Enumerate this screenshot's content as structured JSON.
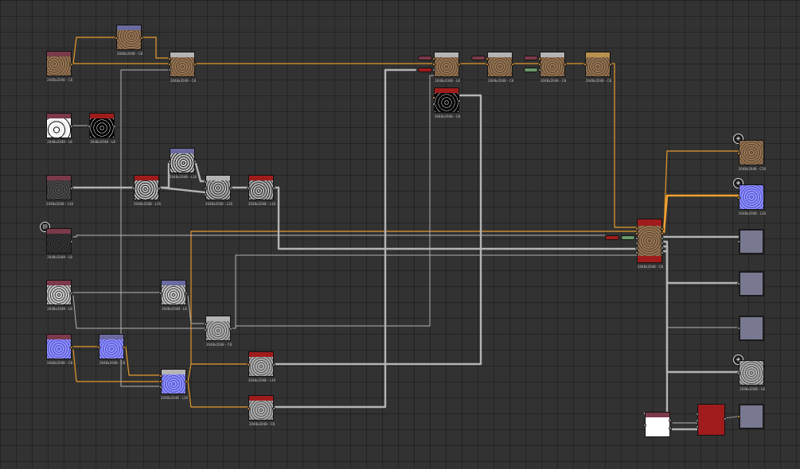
{
  "graph": {
    "nodes": [
      {
        "id": "n1",
        "label": "2048x2048 - C8"
      },
      {
        "id": "n2",
        "label": "2048x2048 - C8"
      },
      {
        "id": "n3",
        "label": "2048x2048 - C8"
      },
      {
        "id": "n4",
        "label": "2048x2048 - L8"
      },
      {
        "id": "n5",
        "label": "2048x2048 - L8"
      },
      {
        "id": "n6",
        "label": "2048x2048 - L16"
      },
      {
        "id": "n7",
        "label": "2048x2048 - L16"
      },
      {
        "id": "n8",
        "label": "2048x2048 - L16"
      },
      {
        "id": "n9",
        "label": "2048x2048 - L16"
      },
      {
        "id": "n10",
        "label": "2048x2048 - L16"
      },
      {
        "id": "n11",
        "label": "2048x2048 - L8"
      },
      {
        "id": "n12",
        "label": "2048x2048 - L8"
      },
      {
        "id": "n13",
        "label": "2048x2048 - L8"
      },
      {
        "id": "n14",
        "label": "2048x2048 - C8"
      },
      {
        "id": "n15",
        "label": "2048x2048 - C8"
      },
      {
        "id": "n16",
        "label": "2048x2048 - L8"
      },
      {
        "id": "n17",
        "label": "2048x2048 - C8"
      },
      {
        "id": "n18",
        "label": "2048x2048 - L16"
      },
      {
        "id": "n19",
        "label": "2048x2048 - L16"
      },
      {
        "id": "n20",
        "label": "2048x2048 - C8"
      },
      {
        "id": "n21",
        "label": "2048x2048 - L8"
      },
      {
        "id": "n22",
        "label": "2048x2048 - C8"
      },
      {
        "id": "n23",
        "label": "2048x2048 - C8"
      },
      {
        "id": "n24",
        "label": "2048x2048 - C8"
      },
      {
        "id": "n25",
        "label": "2048x2048 - C8"
      },
      {
        "id": "n26",
        "label": "2048x2048 - C8"
      },
      {
        "id": "n27",
        "label": "2048x2048 - C16"
      },
      {
        "id": "n28",
        "label": "2048x2048 - L16"
      },
      {
        "id": "n29",
        "label": "2048x2048 - L8"
      }
    ],
    "colors": {
      "wire_default": "#b4b4b4",
      "wire_color": "#e69a2e",
      "head_maroon": "#7a3a4a",
      "head_blue": "#6a6aa0",
      "head_red": "#a01c1c",
      "head_gray": "#b4b4b4",
      "head_tan": "#b89050",
      "output_node": "#787890"
    },
    "icons": {
      "document": "document-icon",
      "output_badge": "output-badge-icon"
    }
  }
}
